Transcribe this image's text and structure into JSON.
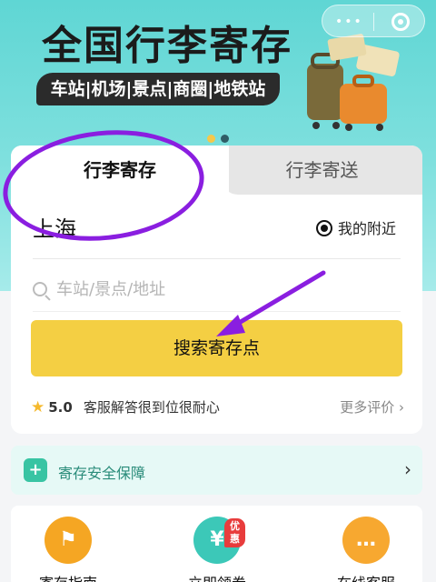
{
  "banner": {
    "title": "全国行李寄存",
    "subtitle": "车站|机场|景点|商圈|地铁站",
    "carousel_dots": 2,
    "active_dot": 0
  },
  "capsule": {
    "more_label": "•••"
  },
  "tabs": [
    {
      "label": "行李寄存",
      "active": true
    },
    {
      "label": "行李寄送",
      "active": false
    }
  ],
  "location": {
    "city": "上海",
    "nearby_label": "我的附近"
  },
  "search": {
    "placeholder": "车站/景点/地址",
    "button_label": "搜索寄存点"
  },
  "rating": {
    "score": "5.0",
    "comment": "客服解答很到位很耐心",
    "more_label": "更多评价 ›"
  },
  "safety": {
    "label": "寄存安全保障",
    "chevron": "›"
  },
  "services": [
    {
      "label": "寄存指南",
      "icon": "signpost-icon",
      "color": "#f5a623"
    },
    {
      "label": "立即领券",
      "icon": "coupon-icon",
      "color": "#3cc8b8",
      "badge": "优惠"
    },
    {
      "label": "在线客服",
      "icon": "chat-icon",
      "color": "#f7a830"
    }
  ],
  "colors": {
    "accent": "#f4cf43",
    "banner": "#5fd6d4",
    "annotation": "#8a1ee0"
  }
}
